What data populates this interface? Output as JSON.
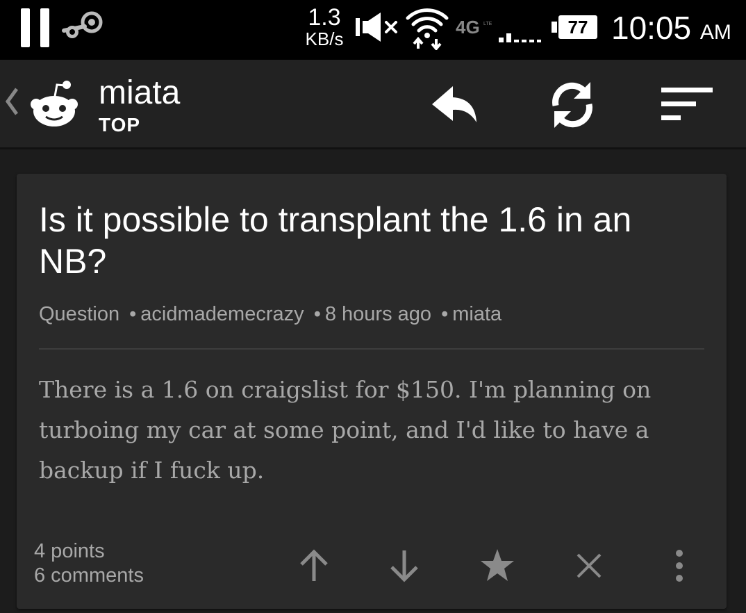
{
  "status_bar": {
    "net_speed_value": "1.3",
    "net_speed_unit": "KB/s",
    "network_type": "4G",
    "battery_percent": "77",
    "time": "10:05",
    "ampm": "AM",
    "icons": [
      "pause-icon",
      "steam-icon",
      "mute-icon",
      "wifi-icon",
      "4g-lte-icon",
      "signal-icon",
      "battery-icon"
    ]
  },
  "app_bar": {
    "subreddit": "miata",
    "sort": "TOP",
    "icons": [
      "back-chevron-icon",
      "reddit-logo-icon",
      "reply-icon",
      "refresh-icon",
      "sort-icon"
    ]
  },
  "post": {
    "title": "Is it possible to transplant the 1.6 in an NB?",
    "flair": "Question",
    "author": "acidmademecrazy",
    "age": "8 hours ago",
    "subreddit": "miata",
    "separator": "•",
    "selftext": "There is a 1.6 on craigslist for $150. I'm planning on turboing my car at some point, and I'd like to have a backup if I fuck up.",
    "points": "4 points",
    "comments": "6 comments",
    "actions": [
      "upvote-icon",
      "downvote-icon",
      "star-icon",
      "close-icon",
      "more-vertical-icon"
    ]
  },
  "colors": {
    "status_bar_bg": "#000000",
    "app_bar_bg": "#222222",
    "page_bg": "#1c1c1c",
    "card_bg": "#2a2a2a",
    "secondary_text": "#a8a8a8",
    "action_icon": "#8a8a8a"
  }
}
